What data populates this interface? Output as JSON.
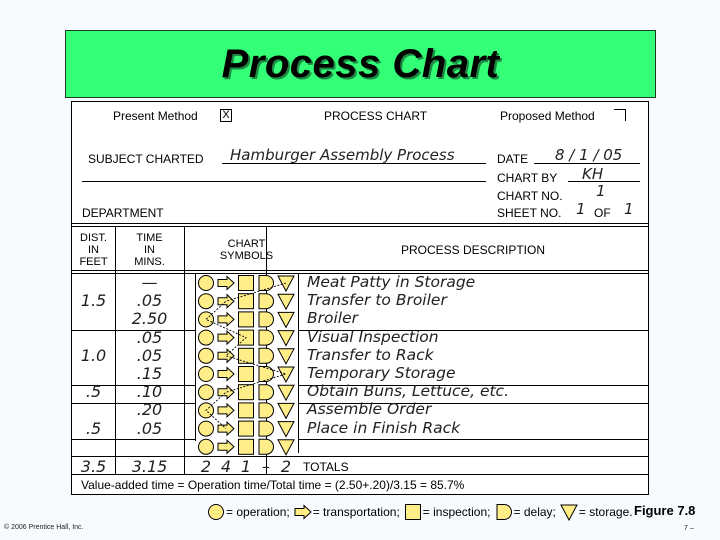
{
  "title": "Process Chart",
  "form": {
    "present_method_label": "Present Method",
    "present_method_mark": "X",
    "heading": "PROCESS CHART",
    "proposed_method_label": "Proposed Method",
    "subject_label": "SUBJECT CHARTED",
    "subject_value": "Hamburger Assembly Process",
    "date_label": "DATE",
    "date_value": "8 / 1 / 05",
    "chart_by_label": "CHART BY",
    "chart_by_value": "KH",
    "chart_no_label": "CHART NO.",
    "chart_no_value": "1",
    "sheet_no_label": "SHEET NO.",
    "sheet_no_value": "1",
    "of_label": "OF",
    "of_value": "1",
    "department_label": "DEPARTMENT"
  },
  "columns": {
    "dist": [
      "DIST.",
      "IN",
      "FEET"
    ],
    "time": [
      "TIME",
      "IN",
      "MINS."
    ],
    "symbols": [
      "CHART",
      "SYMBOLS"
    ],
    "description": "PROCESS DESCRIPTION"
  },
  "steps": [
    {
      "dist": "",
      "time": "—",
      "symbol": "storage",
      "description": "Meat Patty in Storage"
    },
    {
      "dist": "1.5",
      "time": ".05",
      "symbol": "transportation",
      "description": "Transfer to Broiler"
    },
    {
      "dist": "",
      "time": "2.50",
      "symbol": "operation",
      "description": "Broiler"
    },
    {
      "dist": "",
      "time": ".05",
      "symbol": "inspection",
      "description": "Visual Inspection"
    },
    {
      "dist": "1.0",
      "time": ".05",
      "symbol": "transportation",
      "description": "Transfer to Rack"
    },
    {
      "dist": "",
      "time": ".15",
      "symbol": "storage",
      "description": "Temporary Storage"
    },
    {
      "dist": ".5",
      "time": ".10",
      "symbol": "transportation",
      "description": "Obtain Buns, Lettuce, etc."
    },
    {
      "dist": "",
      "time": ".20",
      "symbol": "operation",
      "description": "Assemble Order"
    },
    {
      "dist": ".5",
      "time": ".05",
      "symbol": "transportation",
      "description": "Place in Finish Rack"
    },
    {
      "dist": "",
      "time": "",
      "symbol": "",
      "description": ""
    }
  ],
  "totals": {
    "dist": "3.5",
    "time": "3.15",
    "operation": "2",
    "transportation": "4",
    "inspection": "1",
    "delay": "–",
    "storage": "2",
    "label": "TOTALS"
  },
  "summary": "Value-added time = Operation time/Total time = (2.50+.20)/3.15 = 85.7%",
  "legend": [
    {
      "symbol": "operation",
      "label": "= operation;"
    },
    {
      "symbol": "transportation",
      "label": "= transportation;"
    },
    {
      "symbol": "inspection",
      "label": "= inspection;"
    },
    {
      "symbol": "delay",
      "label": "= delay;"
    },
    {
      "symbol": "storage",
      "label": "= storage."
    }
  ],
  "figure_label": "Figure 7.8",
  "copyright": "© 2006 Prentice Hall, Inc.",
  "page_number": "7 –",
  "colors": {
    "banner": "#33ff77",
    "symbol_fill": "#ffee88",
    "background": "#f7faff"
  }
}
